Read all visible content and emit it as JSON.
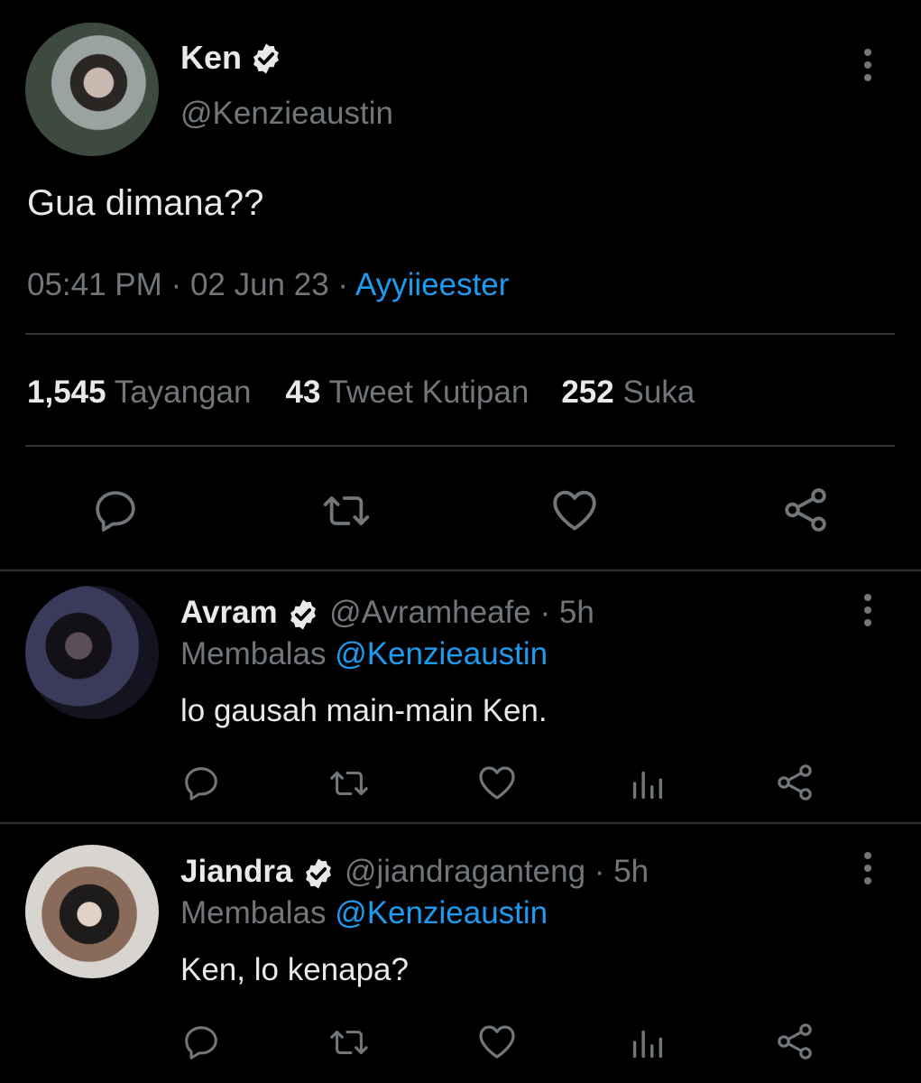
{
  "main_tweet": {
    "display_name": "Ken",
    "handle": "@Kenzieaustin",
    "text": "Gua dimana??",
    "time": "05:41 PM",
    "date": "02 Jun 23",
    "separator": "·",
    "source": "Ayyiieester",
    "stats": {
      "views_count": "1,545",
      "views_label": "Tayangan",
      "quotes_count": "43",
      "quotes_label": "Tweet Kutipan",
      "likes_count": "252",
      "likes_label": "Suka"
    }
  },
  "replies": [
    {
      "display_name": "Avram",
      "handle": "@Avramheafe",
      "separator": "·",
      "time_ago": "5h",
      "replying_label": "Membalas",
      "replying_to": "@Kenzieaustin",
      "text": "lo gausah main-main Ken."
    },
    {
      "display_name": "Jiandra",
      "handle": "@jiandraganteng",
      "separator": "·",
      "time_ago": "5h",
      "replying_label": "Membalas",
      "replying_to": "@Kenzieaustin",
      "text": "Ken, lo kenapa?"
    }
  ],
  "icons": {
    "verified": "verified-badge-icon",
    "reply": "reply-icon",
    "retweet": "retweet-icon",
    "like": "heart-icon",
    "share": "share-icon",
    "views": "views-icon",
    "more": "more-icon"
  },
  "colors": {
    "background": "#000000",
    "text": "#e7e9ea",
    "muted": "#71767b",
    "link": "#1d9bf0",
    "divider": "#2f3336"
  }
}
